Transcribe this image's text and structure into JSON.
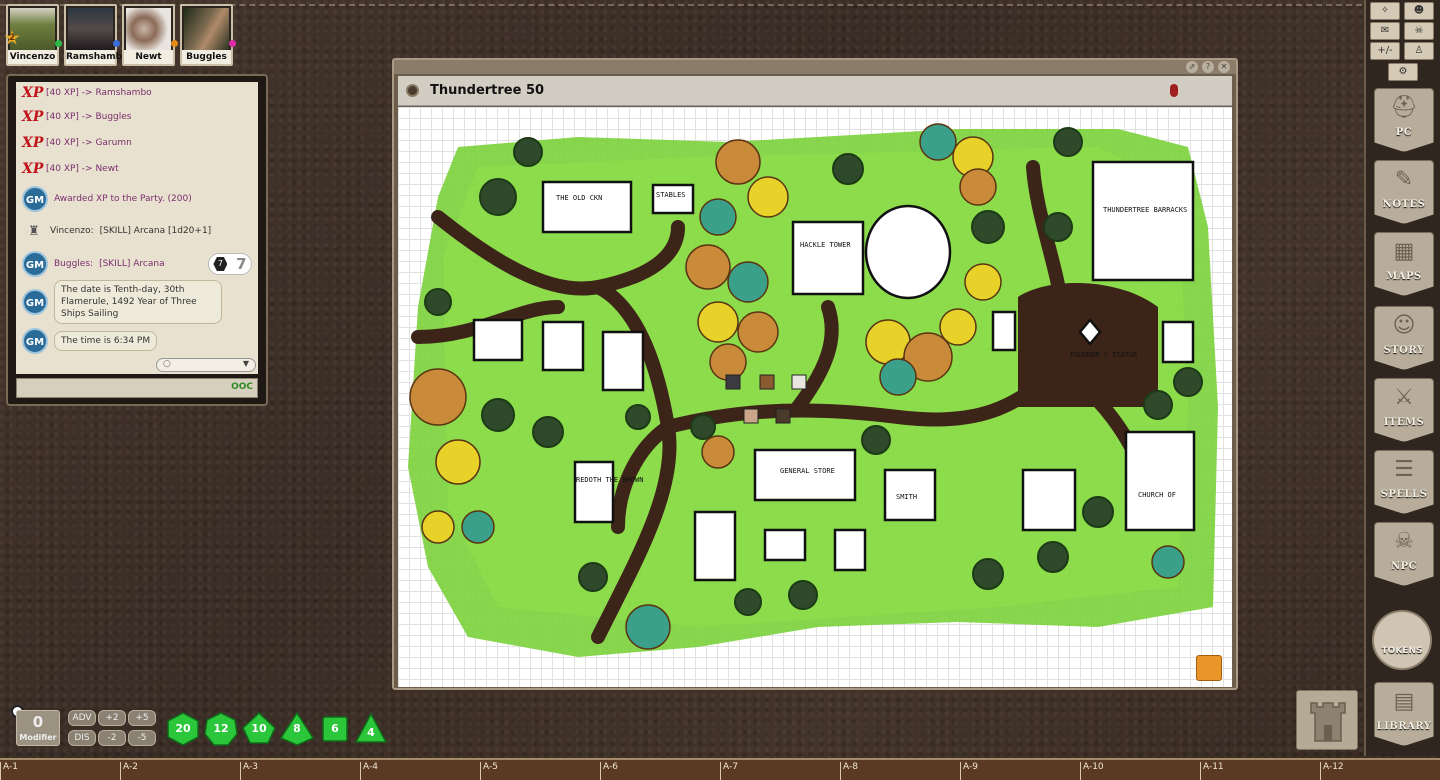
{
  "party": [
    {
      "name": "Vincenzo",
      "level": "2",
      "dot_color": "#2fb84a",
      "pic_color": "#5e6e3a"
    },
    {
      "name": "Ramshambo",
      "dot_color": "#3b6ed8",
      "pic_color": "#3d3a3e"
    },
    {
      "name": "Newt",
      "dot_color": "#e68a1a",
      "pic_color": "#9c7d6a"
    },
    {
      "name": "Buggles",
      "dot_color": "#e12aa5",
      "pic_color": "#3f4a2e"
    }
  ],
  "chat": {
    "lines": [
      {
        "kind": "xp",
        "icon": "XP",
        "text": "[40 XP] -> Ramshambo"
      },
      {
        "kind": "xp",
        "icon": "XP",
        "text": "[40 XP] -> Buggles"
      },
      {
        "kind": "xp",
        "icon": "XP",
        "text": "[40 XP] -> Garumn"
      },
      {
        "kind": "xp",
        "icon": "XP",
        "text": "[40 XP] -> Newt"
      },
      {
        "kind": "gm",
        "icon": "GM",
        "text": "Awarded XP to the Party. (200)"
      },
      {
        "kind": "roll",
        "speaker": "Vincenzo:",
        "text": "[SKILL] Arcana [1d20+1]"
      },
      {
        "kind": "gm",
        "icon": "GM",
        "speaker": "Buggles:",
        "text": "[SKILL] Arcana",
        "die_face": "7",
        "die_total": "7"
      },
      {
        "kind": "gm-bubble",
        "icon": "GM",
        "text": "The date is Tenth-day, 30th Flamerule, 1492 Year of Three Ships Sailing"
      },
      {
        "kind": "gm-bubble",
        "icon": "GM",
        "text": "The time is 6:34 PM"
      }
    ],
    "ooc_label": "OOC"
  },
  "map": {
    "title": "Thundertree 50",
    "labels": {
      "old_kin": "THE OLD CKN",
      "stables": "STABLES",
      "tower": "HACKLE TOWER",
      "barracks": "THUNDERTREE BARRACKS",
      "statue": "FOUNDER'S STATUE",
      "brown": "REDOTH THE BROWN",
      "store": "GENERAL STORE",
      "smith": "SMITH",
      "church": "CHURCH OF"
    }
  },
  "sidebar": {
    "tools": [
      "+/-"
    ],
    "tabs": [
      {
        "label": "PC",
        "icon": "helmet-icon"
      },
      {
        "label": "NOTES",
        "icon": "quill-icon"
      },
      {
        "label": "MAPS",
        "icon": "map-icon"
      },
      {
        "label": "STORY",
        "icon": "masks-icon"
      },
      {
        "label": "ITEMS",
        "icon": "sword-icon"
      },
      {
        "label": "SPELLS",
        "icon": "book-icon"
      },
      {
        "label": "NPC",
        "icon": "skull-icon"
      }
    ],
    "tokens_label": "TOKENS",
    "library_label": "LIBRARY"
  },
  "dice_tray": {
    "modifier_value": "0",
    "modifier_label": "Modifier",
    "buttons": [
      "ADV",
      "+2",
      "+5",
      "DIS",
      "-2",
      "-5"
    ],
    "dice": [
      "20",
      "12",
      "10",
      "8",
      "6",
      "4"
    ]
  },
  "ruler": [
    "A-1",
    "A-2",
    "A-3",
    "A-4",
    "A-5",
    "A-6",
    "A-7",
    "A-8",
    "A-9",
    "A-10",
    "A-11",
    "A-12"
  ]
}
